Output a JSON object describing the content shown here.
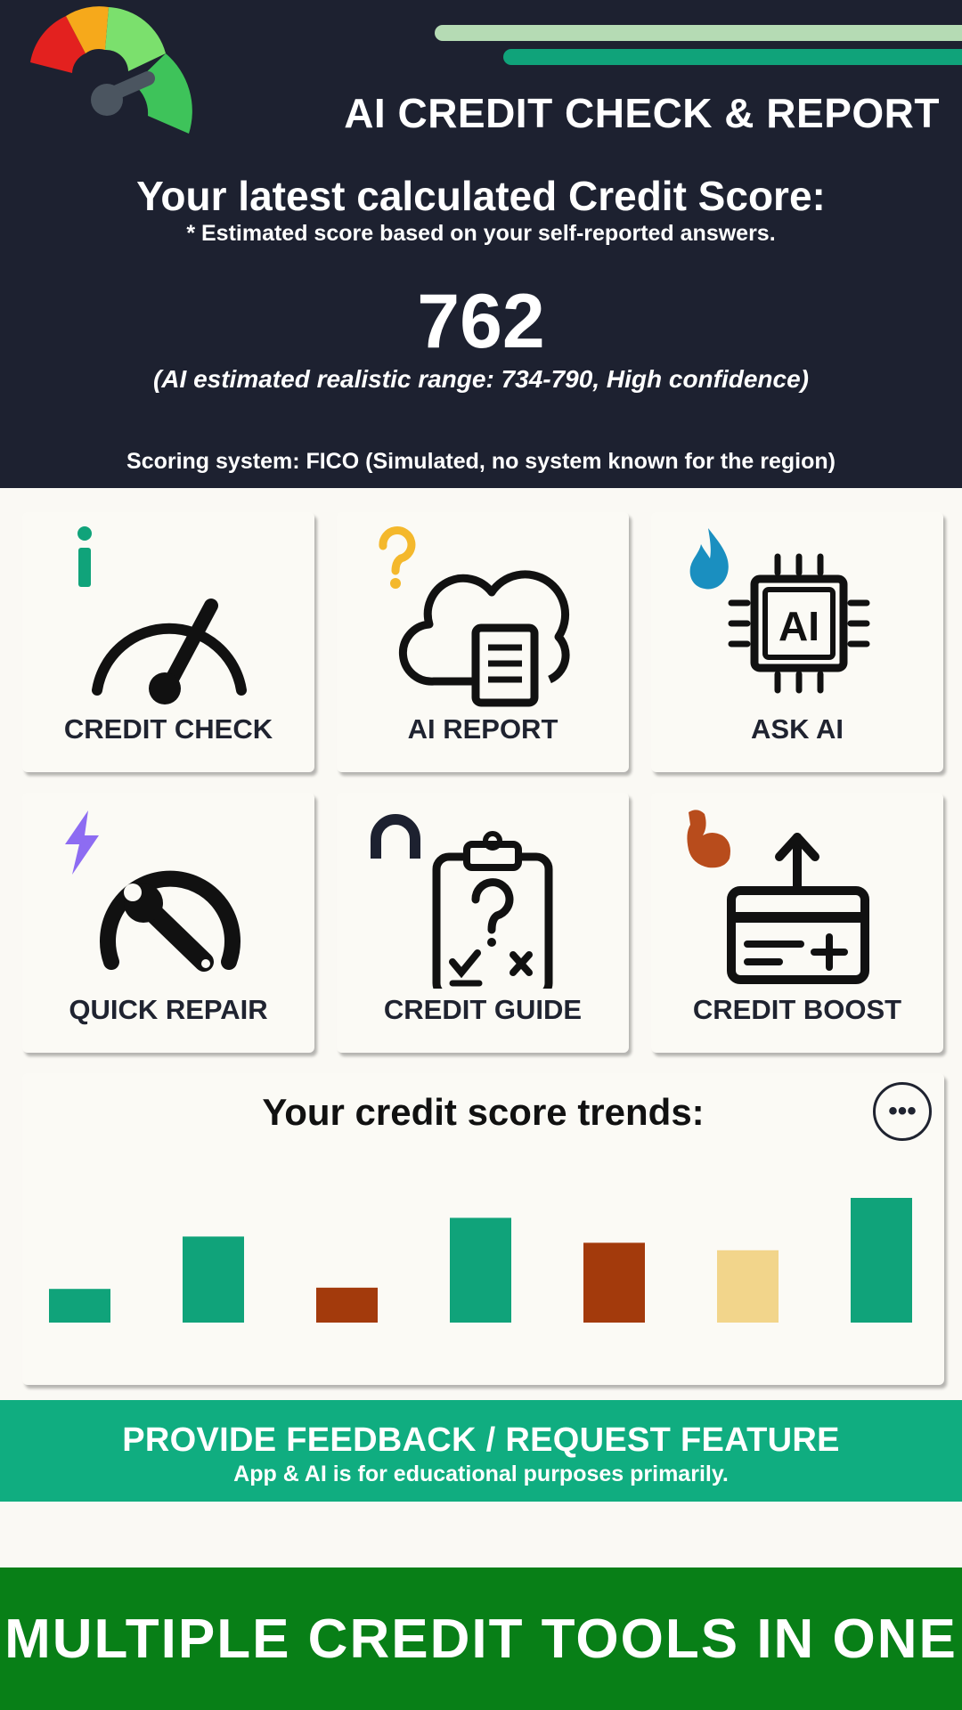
{
  "header": {
    "app_title": "AI CREDIT CHECK & REPORT",
    "score_heading": "Your latest calculated Credit Score:",
    "score_note": "* Estimated score based on your self-reported answers.",
    "score": "762",
    "range_text": "(AI estimated realistic range: 734-790, High confidence)",
    "scoring_system": "Scoring system: FICO (Simulated, no system known for the region)"
  },
  "tiles": [
    {
      "label": "CREDIT CHECK",
      "icon": "speedometer-icon",
      "badge": "info-icon"
    },
    {
      "label": "AI REPORT",
      "icon": "cloud-document-icon",
      "badge": "question-icon"
    },
    {
      "label": "ASK AI",
      "icon": "ai-chip-icon",
      "badge": "flame-icon"
    },
    {
      "label": "QUICK REPAIR",
      "icon": "wrench-gauge-icon",
      "badge": "lightning-icon"
    },
    {
      "label": "CREDIT GUIDE",
      "icon": "clipboard-quiz-icon",
      "badge": "magnet-icon"
    },
    {
      "label": "CREDIT BOOST",
      "icon": "card-upload-icon",
      "badge": "muscle-icon"
    }
  ],
  "chart": {
    "title": "Your credit score trends:",
    "more_icon": "more-options-icon"
  },
  "chart_data": {
    "type": "bar",
    "title": "Your credit score trends:",
    "categories": [
      "",
      "",
      "",
      "",
      "",
      "",
      ""
    ],
    "values": [
      0.27,
      0.69,
      0.28,
      0.84,
      0.64,
      0.58,
      1.0
    ],
    "colors": [
      "#10a37a",
      "#10a37a",
      "#a33a0c",
      "#10a37a",
      "#a33a0c",
      "#f2d58b",
      "#10a37a"
    ],
    "ylim": [
      0,
      1
    ],
    "grid": false
  },
  "feedback": {
    "title": "PROVIDE FEEDBACK / REQUEST FEATURE",
    "subtitle": "App & AI is for educational purposes primarily."
  },
  "banner": {
    "text": "MULTIPLE CREDIT TOOLS IN ONE"
  },
  "colors": {
    "header_bg": "#1d2130",
    "accent_green": "#10a37a",
    "feedback_bg": "#10ad80",
    "banner_bg": "#087f17",
    "rust": "#a33a0c",
    "sand": "#f2d58b"
  }
}
